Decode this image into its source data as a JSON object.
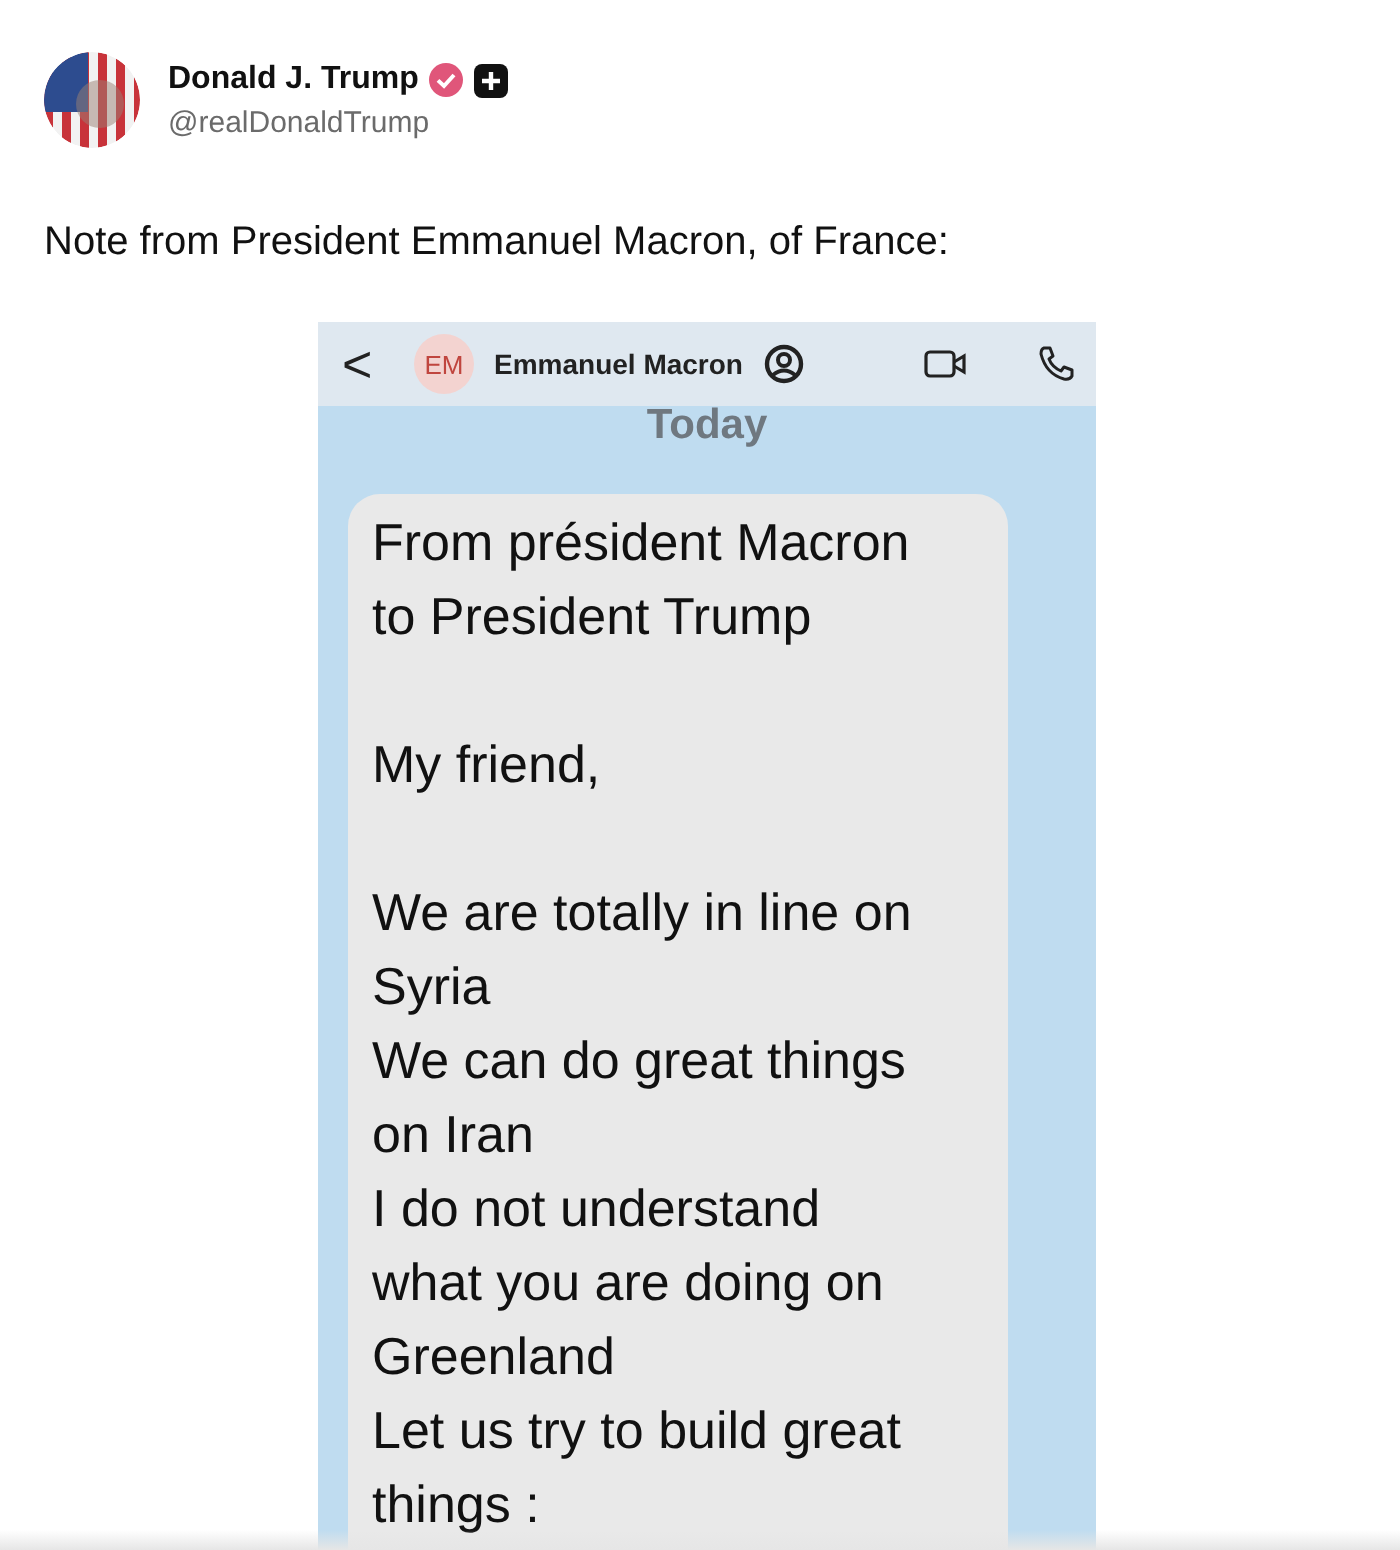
{
  "author": {
    "name": "Donald J. Trump",
    "handle": "@realDonaldTrump",
    "verified": true
  },
  "post_text": "Note from President Emmanuel Macron, of France:",
  "embedded_screenshot": {
    "back": "<",
    "contact_initials": "EM",
    "contact_name": "Emmanuel Macron",
    "date_label": "Today",
    "message_paragraphs": [
      [
        "From président Macron",
        "to President Trump"
      ],
      [
        "My friend,"
      ],
      [
        "We are totally in line on",
        "Syria",
        "We can do great things",
        "on Iran",
        "I do not understand",
        "what you are doing on",
        "Greenland",
        "Let us try to build great",
        "things :"
      ]
    ]
  }
}
